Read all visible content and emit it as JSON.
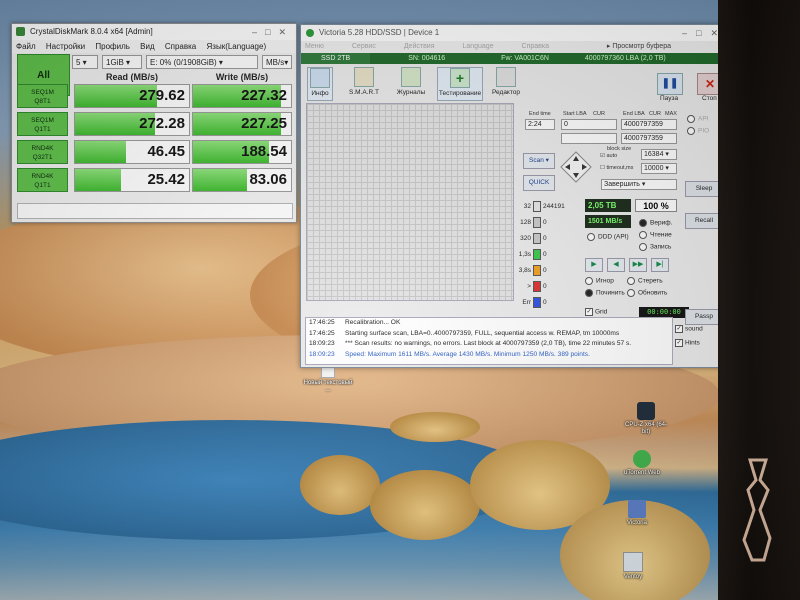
{
  "crystaldiskmark": {
    "title": "CrystalDiskMark 8.0.4 x64 [Admin]",
    "menu": [
      "Файл",
      "Настройки",
      "Профиль",
      "Вид",
      "Справка",
      "Язык(Language)"
    ],
    "all_button": "All",
    "count_select": "5",
    "size_select": "1GiB",
    "drive_select": "E: 0% (0/1908GiB)",
    "unit_select": "MB/s",
    "read_header": "Read (MB/s)",
    "write_header": "Write (MB/s)",
    "rows": [
      {
        "label1": "SEQ1M",
        "label2": "Q8T1",
        "read": "279.62",
        "write": "227.32",
        "read_fill": 0.72,
        "write_fill": 0.9
      },
      {
        "label1": "SEQ1M",
        "label2": "Q1T1",
        "read": "272.28",
        "write": "227.25",
        "read_fill": 0.7,
        "write_fill": 0.9
      },
      {
        "label1": "RND4K",
        "label2": "Q32T1",
        "read": "46.45",
        "write": "188.54",
        "read_fill": 0.45,
        "write_fill": 0.78
      },
      {
        "label1": "RND4K",
        "label2": "Q1T1",
        "read": "25.42",
        "write": "83.06",
        "read_fill": 0.4,
        "write_fill": 0.55
      }
    ]
  },
  "victoria": {
    "title": "Victoria 5.28 HDD/SSD | Device 1",
    "menu": [
      "Меню",
      "Сервис",
      "Действия",
      "Language",
      "Справка",
      "Просмотр буфера"
    ],
    "infobar": {
      "drive": "SSD 2TB",
      "sn": "SN: 004616",
      "fw": "Fw: VA001C6N",
      "lba": "4000797360 LBA (2,0 TB)"
    },
    "toolbar": [
      {
        "label": "Инфо"
      },
      {
        "label": "S.M.A.R.T"
      },
      {
        "label": "Журналы"
      },
      {
        "label": "Тестирование"
      },
      {
        "label": "Редактор"
      }
    ],
    "pause_label": "Пауза",
    "stop_label": "Стоп",
    "end_time_label": "End time",
    "end_time_value": "2:24",
    "start_lba_label": "Start LBA",
    "start_lba_value": "0",
    "end_lba_label": "End LBA",
    "end_lba_value": "4000797359",
    "end_lba_value2": "4000797359",
    "cur_label": "CUR",
    "max_label": "MAX",
    "block_size_label": "block size",
    "auto_label": "auto",
    "block_size_value": "16384",
    "timeout_label": "timeout,ms",
    "timeout_value": "10000",
    "scan_button": "Scan",
    "quick_button": "QUICK",
    "finish_select": "Завершить",
    "latency_rows": [
      {
        "ms": "32",
        "count": "244191",
        "color": "#e6e6e6"
      },
      {
        "ms": "128",
        "count": "0",
        "color": "#c9c9c9"
      },
      {
        "ms": "320",
        "count": "0",
        "color": "#c9c9c9"
      },
      {
        "ms": "1,3s",
        "count": "0",
        "color": "#39c94a"
      },
      {
        "ms": "3,8s",
        "count": "0",
        "color": "#f0a020"
      },
      {
        "ms": ">",
        "count": "0",
        "color": "#e03030"
      },
      {
        "ms": "Err",
        "count": "0",
        "color": "#3050e0"
      }
    ],
    "total_done": "2,05 TB",
    "percent": "100",
    "percent_sign": "%",
    "speed": "1501 MB/s",
    "ddd_label": "DDD (API)",
    "verify_label": "Вериф.",
    "read_label": "Чтение",
    "write_label": "Запись",
    "ignore_label": "Игнор",
    "erase_label": "Стереть",
    "repair_label": "Починить",
    "update_label": "Обновить",
    "grid_label": "Grid",
    "timer": "00:00:00",
    "side": {
      "api": "API",
      "pio": "PIO",
      "sleep": "Sleep",
      "recall": "Recall",
      "passp": "Passp"
    },
    "log": [
      {
        "time": "17:46:25",
        "text": "Recalibration... OK",
        "blue": false
      },
      {
        "time": "17:46:25",
        "text": "Starting surface scan, LBA=0..4000797359, FULL, sequential access w. REMAP, tm 10000ms",
        "blue": false
      },
      {
        "time": "18:09:23",
        "text": "*** Scan results: no warnings, no errors. Last block at 4000797359 (2,0 TB), time 22 minutes 57 s.",
        "blue": false
      },
      {
        "time": "18:09:23",
        "text": "Speed: Maximum 1611 MB/s. Average 1430 MB/s. Minimum 1250 MB/s. 389 points.",
        "blue": true
      }
    ],
    "sound_label": "sound",
    "hints_label": "Hints"
  },
  "desktop_icons": [
    {
      "label": "Новый текстовый ...",
      "icon": "text-file-icon"
    },
    {
      "label": "CPU-Z x64 (64-bit)",
      "icon": "cpuz-icon"
    },
    {
      "label": "uTorrent Web",
      "icon": "utorrent-icon"
    },
    {
      "label": "Victoria",
      "icon": "victoria-icon"
    },
    {
      "label": "Ventoy",
      "icon": "ventoy-icon"
    }
  ]
}
